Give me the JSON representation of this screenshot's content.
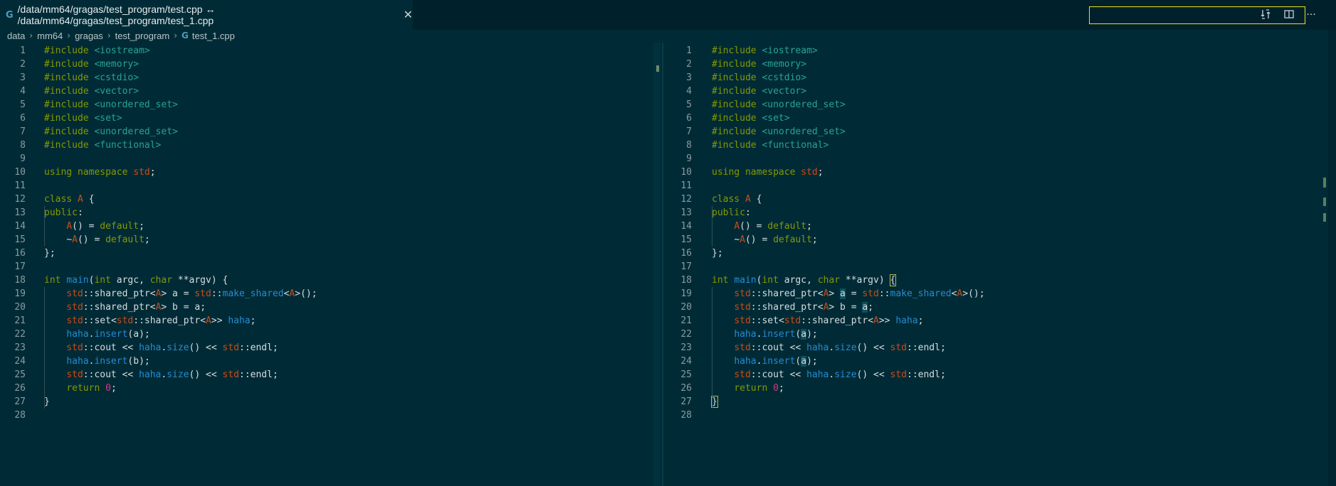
{
  "tab": {
    "icon_glyph": "G",
    "title": "/data/mm64/gragas/test_program/test.cpp ↔ /data/mm64/gragas/test_program/test_1.cpp",
    "close_glyph": "✕"
  },
  "toolbar": {
    "compare_icon": "git-compare-icon",
    "split_icon": "split-editor-icon",
    "more_glyph": "···"
  },
  "breadcrumb": {
    "items": [
      "data",
      "mm64",
      "gragas",
      "test_program"
    ],
    "sep_glyph": "›",
    "file_icon": "G",
    "file": "test_1.cpp"
  },
  "line_numbers": [
    "1",
    "2",
    "3",
    "4",
    "5",
    "6",
    "7",
    "8",
    "9",
    "10",
    "11",
    "12",
    "13",
    "14",
    "15",
    "16",
    "17",
    "18",
    "19",
    "20",
    "21",
    "22",
    "23",
    "24",
    "25",
    "26",
    "27",
    "28"
  ],
  "left_code": [
    "#include <iostream>",
    "#include <memory>",
    "#include <cstdio>",
    "#include <vector>",
    "#include <unordered_set>",
    "#include <set>",
    "#include <unordered_set>",
    "#include <functional>",
    "",
    "using namespace std;",
    "",
    "class A {",
    "public:",
    "    A() = default;",
    "    ~A() = default;",
    "};",
    "",
    "int main(int argc, char **argv) {",
    "    std::shared_ptr<A> a = std::make_shared<A>();",
    "    std::shared_ptr<A> b = a;",
    "    std::set<std::shared_ptr<A>> haha;",
    "    haha.insert(a);",
    "    std::cout << haha.size() << std::endl;",
    "    haha.insert(b);",
    "    std::cout << haha.size() << std::endl;",
    "    return 0;",
    "}",
    ""
  ],
  "right_code": [
    "#include <iostream>",
    "#include <memory>",
    "#include <cstdio>",
    "#include <vector>",
    "#include <unordered_set>",
    "#include <set>",
    "#include <unordered_set>",
    "#include <functional>",
    "",
    "using namespace std;",
    "",
    "class A {",
    "public:",
    "    A() = default;",
    "    ~A() = default;",
    "};",
    "",
    "int main(int argc, char **argv) {",
    "    std::shared_ptr<A> a = std::make_shared<A>();",
    "    std::shared_ptr<A> b = a;",
    "    std::set<std::shared_ptr<A>> haha;",
    "    haha.insert(a);",
    "    std::cout << haha.size() << std::endl;",
    "    haha.insert(a);",
    "    std::cout << haha.size() << std::endl;",
    "    return 0;",
    "}",
    ""
  ],
  "colors": {
    "background": "#002b36",
    "keyword": "#859900",
    "include": "#2aa198",
    "function": "#268bd2",
    "type": "#cb4b16",
    "number": "#d33682",
    "find_border": "#e4e420"
  }
}
